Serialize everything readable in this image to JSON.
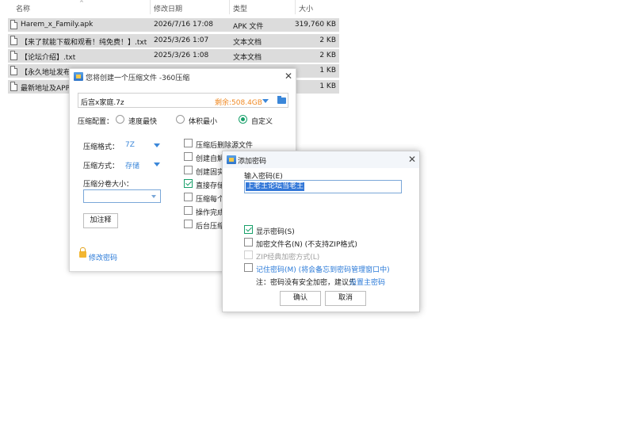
{
  "explorer": {
    "columns": {
      "name": "名称",
      "date": "修改日期",
      "type": "类型",
      "size": "大小"
    },
    "rows": [
      {
        "name": "Harem_x_Family.apk",
        "date": "2026/7/16 17:08",
        "type": "APK 文件",
        "size": "319,760 KB"
      },
      {
        "name": "【来了就能下载和观看！纯免费！】.txt",
        "date": "2025/3/26 1:07",
        "type": "文本文档",
        "size": "2 KB"
      },
      {
        "name": "【论坛介绍】.txt",
        "date": "2025/3/26 1:08",
        "type": "文本文档",
        "size": "2 KB"
      },
      {
        "name": "【永久地址发布",
        "date": "",
        "type": "",
        "size": "1 KB"
      },
      {
        "name": "最新地址及APP",
        "date": "",
        "type": "",
        "size": "1 KB"
      }
    ]
  },
  "compress_dialog": {
    "title": "您将创建一个压缩文件 -360压缩",
    "filename": "后宫x家庭.7z",
    "free_space": "剩余:508.4GB",
    "config_label": "压缩配置：",
    "modes": [
      "速度最快",
      "体积最小",
      "自定义"
    ],
    "selected_mode": "自定义",
    "format_label": "压缩格式：",
    "format_value": "7Z",
    "method_label": "压缩方式：",
    "method_value": "存储",
    "volume_label": "压缩分卷大小：",
    "volume_value": "",
    "comment_button": "加注释",
    "password_link": "修改密码",
    "options": [
      {
        "label": "压缩后删除源文件",
        "checked": false
      },
      {
        "label": "创建自解",
        "checked": false
      },
      {
        "label": "创建固实",
        "checked": false
      },
      {
        "label": "直接存储",
        "checked": true
      },
      {
        "label": "压缩每个",
        "checked": false
      },
      {
        "label": "操作完成",
        "checked": false
      },
      {
        "label": "后台压缩",
        "checked": false
      }
    ]
  },
  "password_dialog": {
    "title": "添加密码",
    "input_label": "输入密码(E)",
    "password_value": "上老王论坛当老王",
    "show_password": "显示密码(S)",
    "encrypt_names": "加密文件名(N) (不支持ZIP格式)",
    "zip_classic": "ZIP经典加密方式(L)",
    "remember": "记住密码(M) (将会备忘到密码管理窗口中)",
    "note_prefix": "注：密码没有安全加密，建议先",
    "note_link": "设置主密码",
    "ok_label": "确认",
    "cancel_label": "取消",
    "colors": {
      "accent": "#3478d8",
      "check": "#18a06a",
      "free_space": "#f08a24"
    }
  }
}
